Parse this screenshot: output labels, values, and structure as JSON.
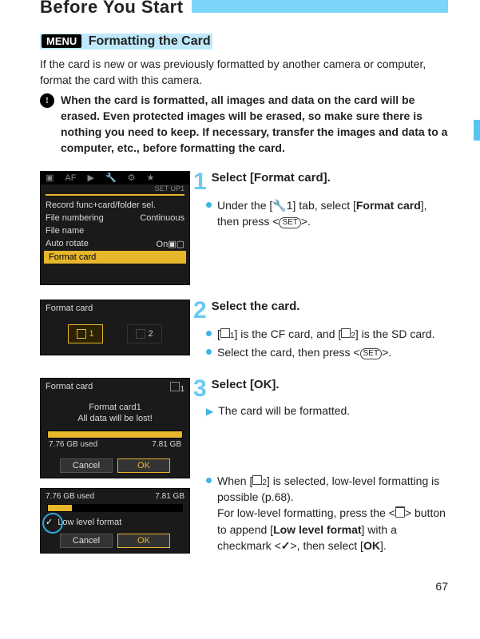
{
  "header": {
    "title": "Before You Start"
  },
  "section": {
    "badge": "MENU",
    "title": "Formatting the Card"
  },
  "intro": "If the card is new or was previously formatted by another camera or computer, format the card with this camera.",
  "warning": "When the card is formatted, all images and data on the card will be erased. Even protected images will be erased, so make sure there is nothing you need to keep. If necessary, transfer the images and data to a computer, etc., before formatting the card.",
  "steps": {
    "s1": {
      "num": "1",
      "title": "Select [Format card].",
      "line1a": "Under the [",
      "line1b": "1] tab, select [",
      "line1c": "Format card",
      "line1d": "], then press <",
      "line1e": ">."
    },
    "s2": {
      "num": "2",
      "title": "Select the card.",
      "l1a": "[",
      "l1b": "] is the CF card, and [",
      "l1c": "] is the SD card.",
      "l2a": "Select the card, then press <",
      "l2b": ">."
    },
    "s3": {
      "num": "3",
      "title": "Select [OK].",
      "l1": "The card will be formatted."
    },
    "s4": {
      "l1a": "When [",
      "l1b": "] is selected, low-level formatting is possible (p.68).",
      "l2a": "For low-level formatting, press the <",
      "l2b": "> button to append [",
      "l2c": "Low level format",
      "l2d": "] with a checkmark <",
      "l2e": ">, then select [",
      "l2f": "OK",
      "l2g": "]."
    }
  },
  "fig1": {
    "setlabel": "SET UP1",
    "rows": {
      "r1": "Record func+card/folder sel.",
      "r2a": "File numbering",
      "r2b": "Continuous",
      "r3": "File name",
      "r4a": "Auto rotate",
      "r4b": "On",
      "r5": "Format card"
    }
  },
  "fig2": {
    "head": "Format card",
    "c1": "1",
    "c2": "2"
  },
  "fig3": {
    "head": "Format card",
    "icon": "1",
    "body1": "Format card1",
    "body2": "All data will be lost!",
    "used": "7.76 GB used",
    "total": "7.81 GB",
    "cancel": "Cancel",
    "ok": "OK"
  },
  "fig4": {
    "used": "7.76 GB used",
    "total": "7.81 GB",
    "low": "Low level format",
    "cancel": "Cancel",
    "ok": "OK"
  },
  "icons": {
    "set": "SET",
    "card1": "1",
    "card2": "2",
    "wrench": "🔧",
    "check": "✓"
  },
  "pagenum": "67"
}
